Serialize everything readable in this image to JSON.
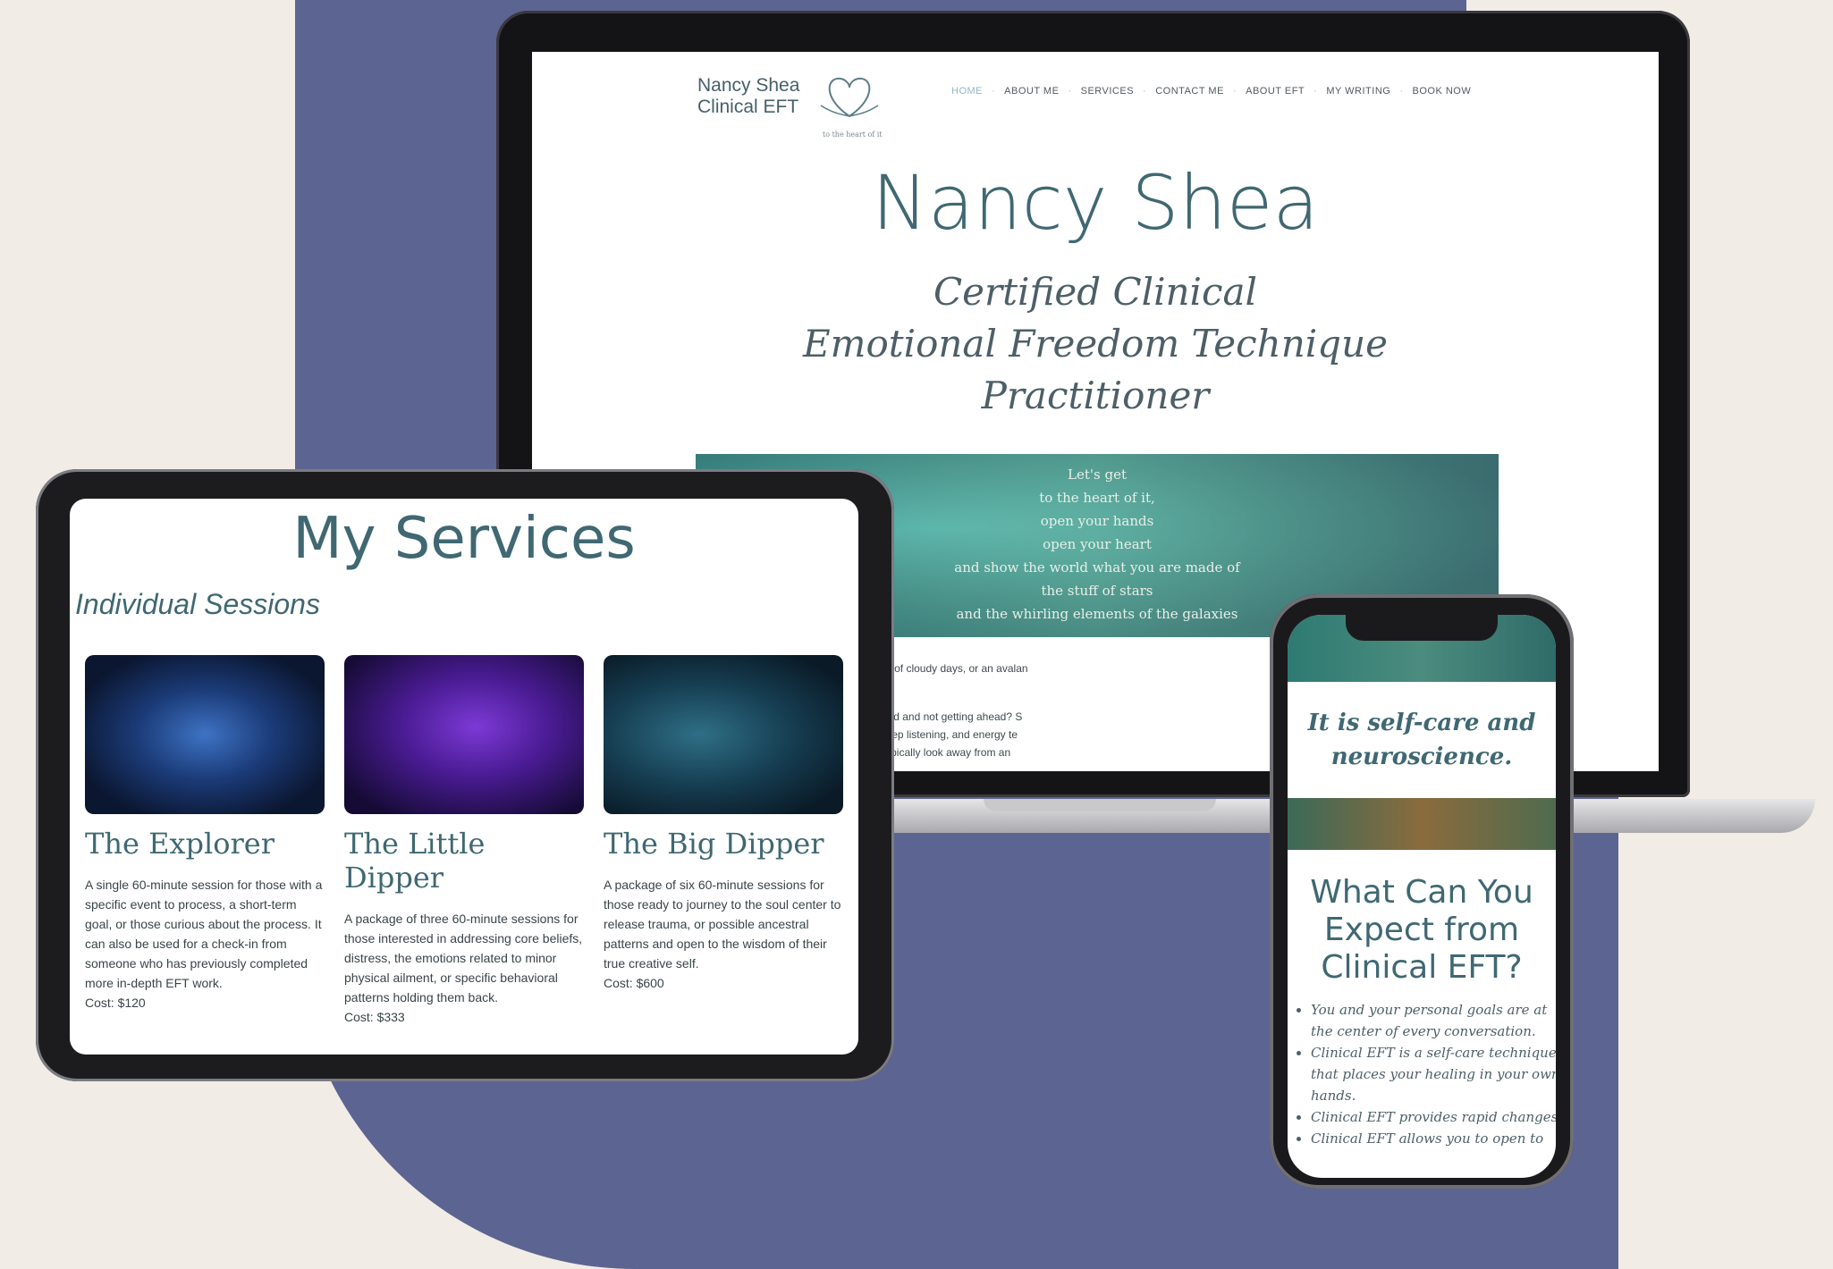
{
  "colors": {
    "background": "#f2ece7",
    "blob": "#5c6592",
    "accent_teal": "#3f6872",
    "nav_active": "#8fb7c4"
  },
  "laptop": {
    "logo": {
      "line1": "Nancy Shea",
      "line2": "Clinical EFT",
      "tagline": "to the heart of it",
      "icon": "heart-hands-icon"
    },
    "nav": [
      "HOME",
      "ABOUT ME",
      "SERVICES",
      "CONTACT ME",
      "ABOUT EFT",
      "MY WRITING",
      "BOOK NOW"
    ],
    "hero": {
      "name": "Nancy Shea",
      "subtitle_lines": [
        "Certified Clinical",
        "Emotional Freedom Technique",
        "Practitioner"
      ]
    },
    "banner_poem": [
      "Let's get",
      "to the heart of it,",
      "open your hands",
      "open your heart",
      "and show the world what you are made of",
      "the stuff of stars",
      "and the whirling elements of the galaxies"
    ],
    "body_paragraphs": [
      "ays shining. Whether it has been years of cloudy days, or an avalan\nf your true self destiny, it still shines.",
      "alone and misunderstood? Working hard and not getting ahead? S\nf. You are not alone. Using curiosity, deep listening, and energy te\nn bravely look at that which you may typically look away from an"
    ]
  },
  "tablet": {
    "title": "My Services",
    "section": "Individual Sessions",
    "cards": [
      {
        "name": "The Explorer",
        "description": "A single 60-minute session for those with a specific event to process, a short-term goal, or those curious about the process. It can also be used for a check-in from someone who has previously completed more in-depth EFT work.",
        "cost": "Cost: $120"
      },
      {
        "name": "The Little Dipper",
        "description": "A package of three 60-minute sessions for those interested in addressing core beliefs, distress, the emotions related to minor physical ailment, or specific behavioral patterns holding them back.",
        "cost": "Cost: $333"
      },
      {
        "name": "The Big Dipper",
        "description": "A package of six 60-minute sessions for those ready to journey to the soul center to release trauma, or possible ancestral patterns and open to the wisdom of their true creative self.",
        "cost": "Cost: $600"
      }
    ]
  },
  "phone": {
    "quote": "It is self-care and neuroscience.",
    "heading": "What Can You Expect from Clinical EFT?",
    "bullets": [
      "You and your personal goals are at the center of every conversation.",
      "Clinical EFT is a self-care technique that places your healing in your own hands.",
      "Clinical EFT provides rapid changes.",
      "Clinical EFT allows you to open to"
    ]
  }
}
